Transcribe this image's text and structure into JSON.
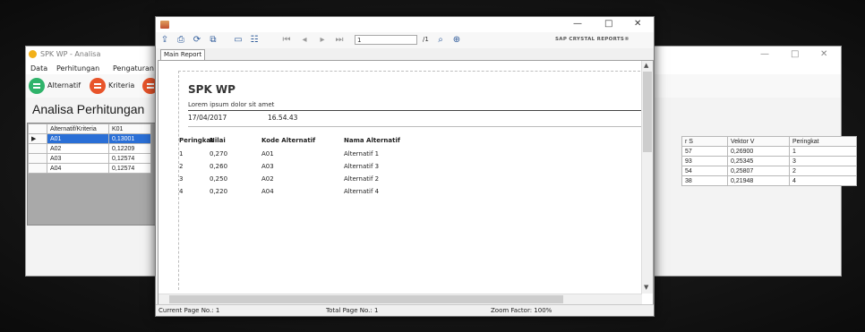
{
  "back_window": {
    "title": "SPK WP - Analisa",
    "menu": [
      "Data",
      "Perhitungan",
      "Pengaturan"
    ],
    "tools": [
      {
        "label": "Alternatif",
        "color": "#2fb36a"
      },
      {
        "label": "Kriteria",
        "color": "#e8542a"
      },
      {
        "label": "",
        "color": "#e8542a"
      }
    ],
    "heading": "Analisa Perhitungan",
    "left_grid": {
      "headers": [
        "Alternatif/Kriteria",
        "K01"
      ],
      "rows": [
        [
          "A01",
          "0,13001"
        ],
        [
          "A02",
          "0,12209"
        ],
        [
          "A03",
          "0,12574"
        ],
        [
          "A04",
          "0,12574"
        ]
      ],
      "row_marker": "▶"
    },
    "right_grid": {
      "headers": [
        "r S",
        "Vektor V",
        "Peringkat"
      ],
      "rows": [
        [
          "57",
          "0,26900",
          "1"
        ],
        [
          "93",
          "0,25345",
          "3"
        ],
        [
          "54",
          "0,25807",
          "2"
        ],
        [
          "38",
          "0,21948",
          "4"
        ]
      ]
    },
    "window_buttons": [
      "—",
      "□",
      "✕"
    ]
  },
  "report_window": {
    "window_buttons": [
      "—",
      "□",
      "✕"
    ],
    "toolbar": {
      "page_input": "1",
      "page_count": "/1",
      "brand": "SAP CRYSTAL REPORTS®"
    },
    "tab": "Main Report",
    "report": {
      "title": "SPK WP",
      "subtitle": "Lorem ipsum dolor sit amet",
      "date": "17/04/2017",
      "time": "16.54.43",
      "columns": [
        "Peringkat",
        "Nilai",
        "Kode Alternatif",
        "Nama Alternatif"
      ],
      "rows": [
        [
          "1",
          "0,270",
          "A01",
          "Alternatif 1"
        ],
        [
          "2",
          "0,260",
          "A03",
          "Alternatif 3"
        ],
        [
          "3",
          "0,250",
          "A02",
          "Alternatif 2"
        ],
        [
          "4",
          "0,220",
          "A04",
          "Alternatif 4"
        ]
      ]
    },
    "status": {
      "current_page": "Current Page No.: 1",
      "total_page": "Total Page No.: 1",
      "zoom": "Zoom Factor: 100%"
    }
  }
}
